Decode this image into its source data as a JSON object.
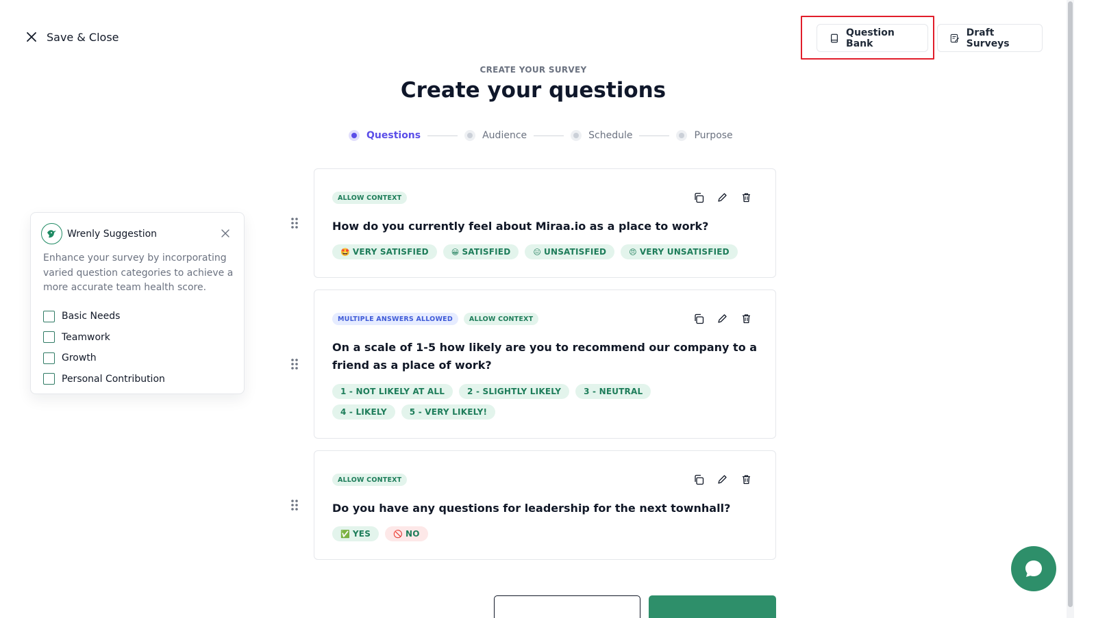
{
  "top": {
    "save_close": "Save & Close",
    "question_bank": "Question Bank",
    "draft_surveys": "Draft Surveys"
  },
  "header": {
    "eyebrow": "CREATE YOUR SURVEY",
    "title": "Create your questions"
  },
  "steps": [
    {
      "label": "Questions",
      "active": true
    },
    {
      "label": "Audience",
      "active": false
    },
    {
      "label": "Schedule",
      "active": false
    },
    {
      "label": "Purpose",
      "active": false
    }
  ],
  "suggestion": {
    "title": "Wrenly Suggestion",
    "description": "Enhance your survey by incorporating varied question categories to achieve a more accurate team health score.",
    "categories": [
      "Basic Needs",
      "Teamwork",
      "Growth",
      "Personal Contribution"
    ]
  },
  "questions": [
    {
      "tags": [
        "ALLOW CONTEXT"
      ],
      "text": "How do you currently feel about Miraa.io as a place to work?",
      "answers": [
        {
          "emoji": "🤩",
          "label": "VERY SATISFIED"
        },
        {
          "emoji": "😀",
          "label": "SATISFIED"
        },
        {
          "emoji": "😐",
          "label": "UNSATISFIED"
        },
        {
          "emoji": "😠",
          "label": "VERY UNSATISFIED"
        }
      ]
    },
    {
      "tags": [
        "MULTIPLE ANSWERS ALLOWED",
        "ALLOW CONTEXT"
      ],
      "text": "On a scale of 1-5 how likely are you to recommend our company to a friend as a place of work?",
      "answers": [
        {
          "emoji": "",
          "label": "1 - NOT LIKELY AT ALL"
        },
        {
          "emoji": "",
          "label": "2 - SLIGHTLY LIKELY"
        },
        {
          "emoji": "",
          "label": "3 - NEUTRAL"
        },
        {
          "emoji": "",
          "label": "4 - LIKELY"
        },
        {
          "emoji": "",
          "label": "5 - VERY LIKELY!"
        }
      ]
    },
    {
      "tags": [
        "ALLOW CONTEXT"
      ],
      "text": "Do you have any questions for leadership for the next townhall?",
      "answers": [
        {
          "emoji": "✅",
          "label": "YES"
        },
        {
          "emoji": "🚫",
          "label": "NO"
        }
      ]
    }
  ],
  "colors": {
    "accent_purple": "#5b4ee8",
    "brand_green": "#2e8f6a",
    "tag_green_bg": "#e3f4ec",
    "tag_green_text": "#1e7d5a",
    "tag_blue_bg": "#e6ecff",
    "tag_blue_text": "#3f5bd8",
    "highlight_red": "#e11d2a"
  },
  "icons": {
    "close": "close-icon",
    "question_bank": "book-icon",
    "draft_surveys": "edit-note-icon",
    "copy": "copy-icon",
    "edit": "pencil-icon",
    "delete": "trash-icon",
    "drag": "drag-handle-icon",
    "chat": "chat-bubble-icon"
  }
}
